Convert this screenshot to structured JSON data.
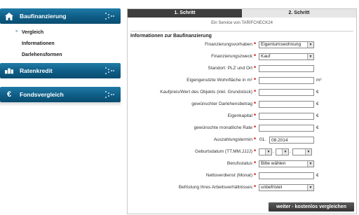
{
  "sidebar": {
    "baufinanzierung": {
      "label": "Baufinanzierung",
      "icon": "house-icon"
    },
    "sub_items": [
      {
        "label": "Vergleich"
      },
      {
        "label": "Informationen"
      },
      {
        "label": "Darlehensformen"
      }
    ],
    "ratenkredit": {
      "label": "Ratenkredit",
      "icon": "coins-icon"
    },
    "fondsvergleich": {
      "label": "Fondsvergleich",
      "icon": "euro-icon"
    },
    "colors": {
      "header": "#0e5d86"
    }
  },
  "tabs": [
    {
      "label": "1. Schritt",
      "active": true
    },
    {
      "label": "2. Schritt",
      "active": false
    }
  ],
  "service_note": "Ein Service von TARIFCHECK24",
  "section_title": "Informationen zur Baufinanzierung",
  "form": {
    "finanzierungsvorhaben": {
      "label": "Finanzierungsvorhaben",
      "value": "Eigentumswohnung"
    },
    "finanzierungszweck": {
      "label": "Finanzierungszweck",
      "value": "Kauf"
    },
    "standort": {
      "label": "Standort: PLZ und Ort",
      "value": ""
    },
    "wohnflaeche": {
      "label": "Eigengenutzte Wohnfläche in m²",
      "value": "",
      "unit": "m²"
    },
    "kaufpreis": {
      "label": "Kaufpreis/Wert des Objekts (inkl. Grundstück)",
      "value": "",
      "unit": "€"
    },
    "darlehensbetrag": {
      "label": "gewünschter Darlehensbetrag",
      "value": "",
      "unit": "€"
    },
    "eigenkapital": {
      "label": "Eigenkapital",
      "value": "",
      "unit": "€"
    },
    "monatliche_rate": {
      "label": "gewünschte monatliche Rate",
      "value": "",
      "unit": "€"
    },
    "auszahlungstermin": {
      "label": "Auszahlungstermin",
      "prefix": "01.",
      "value": "08.2014"
    },
    "geburtsdatum": {
      "label": "Geburtsdatum (TT.MM.JJJJ)",
      "sep": "."
    },
    "berufsstatus": {
      "label": "Berufsstatus",
      "value": "Bitte wählen"
    },
    "nettoverdienst": {
      "label": "Nettoverdienst (Monat)",
      "value": "",
      "unit": "€"
    },
    "befristung": {
      "label": "Befristung Ihres Arbeitsverhältnisses",
      "value": "unbefristet"
    }
  },
  "submit_label": "weiter - kostenlos vergleichen",
  "required_marker": "*"
}
